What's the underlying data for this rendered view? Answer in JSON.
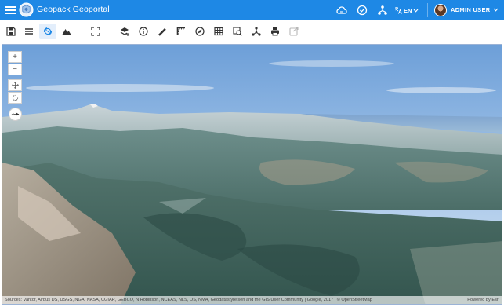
{
  "app": {
    "title": "Geopack Geoportal"
  },
  "header": {
    "language": "EN",
    "user_name": "ADMIN USER"
  },
  "toolbar": {
    "buttons": [
      {
        "icon": "save-icon"
      },
      {
        "icon": "list-icon"
      },
      {
        "icon": "globe-rotate-icon",
        "active": true
      },
      {
        "icon": "terrain-icon"
      },
      {
        "icon": "fullscreen-icon"
      },
      {
        "icon": "layers-add-icon"
      },
      {
        "icon": "info-icon"
      },
      {
        "icon": "ruler-icon"
      },
      {
        "icon": "measure-area-icon"
      },
      {
        "icon": "compass-icon"
      },
      {
        "icon": "table-icon"
      },
      {
        "icon": "search-layer-icon"
      },
      {
        "icon": "network-icon"
      },
      {
        "icon": "print-icon"
      },
      {
        "icon": "export-icon",
        "disabled": true
      }
    ]
  },
  "map_controls": {
    "zoom_in": "+",
    "zoom_out": "−"
  },
  "attribution": {
    "sources": "Sources: Vantor, Airbus DS, USGS, NGA, NASA, CGIAR, GEBCO, N Robinson, NCEAS, NLS, OS, NMA, Geodatastyrelsen and the GIS User Community | Google, 2017 | © OpenStreetMap",
    "powered": "Powered by Esri"
  },
  "colors": {
    "appbar": "#1e88e5",
    "accent": "#1e88e5"
  }
}
